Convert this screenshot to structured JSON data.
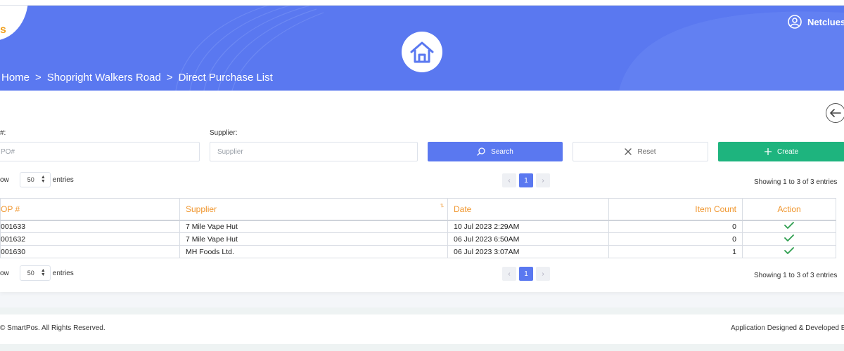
{
  "header": {
    "logo_text": "s",
    "breadcrumb": [
      "Home",
      "Shopright Walkers Road",
      "Direct Purchase List"
    ],
    "breadcrumb_sep": ">",
    "user_name": "Netclues"
  },
  "filters": {
    "po_label": "#:",
    "po_placeholder": "PO#",
    "supplier_label": "Supplier:",
    "supplier_placeholder": "Supplier",
    "search_label": "Search",
    "reset_label": "Reset",
    "create_label": "Create"
  },
  "length": {
    "show_label": "ow",
    "value": "50",
    "entries_label": "entries"
  },
  "pagination": {
    "current_page": "1",
    "info": "Showing 1 to 3 of 3 entries"
  },
  "table": {
    "columns": [
      "OP #",
      "Supplier",
      "Date",
      "Item Count",
      "Action"
    ],
    "sort_glyph": "↑↓",
    "rows": [
      {
        "po": "001633",
        "supplier": "7 Mile Vape Hut",
        "date": "10 Jul 2023 2:29AM",
        "count": "0"
      },
      {
        "po": "001632",
        "supplier": "7 Mile Vape Hut",
        "date": "06 Jul 2023 6:50AM",
        "count": "0"
      },
      {
        "po": "001630",
        "supplier": "MH Foods Ltd.",
        "date": "06 Jul 2023 3:07AM",
        "count": "1"
      }
    ]
  },
  "footer": {
    "copyright": "© SmartPos. All Rights Reserved.",
    "credit": "Application Designed & Developed B"
  },
  "colors": {
    "header_bg": "#5a78f0",
    "accent_orange": "#f0962e",
    "create_green": "#1eb47e",
    "check_green": "#2e9e4f"
  }
}
